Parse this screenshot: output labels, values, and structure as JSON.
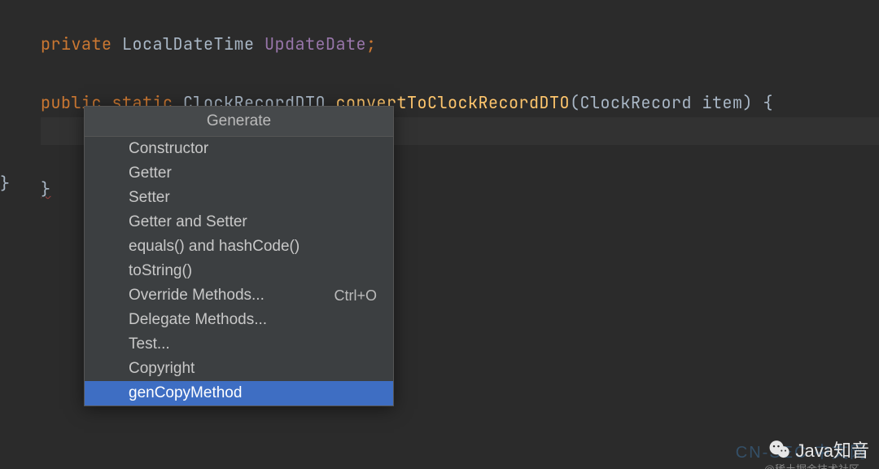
{
  "code": {
    "line1": {
      "kw": "private",
      "type": "LocalDateTime",
      "field": "UpdateDate",
      "semi": ";"
    },
    "line3": {
      "kw1": "public",
      "kw2": "static",
      "ret": "ClockRecordDTO",
      "method": "convertToClockRecordDTO",
      "lparen": "(",
      "ptype": "ClockRecord",
      "pname": "item",
      "rparen": ")",
      "lbrace": "{"
    },
    "line5": {
      "rbrace": "}"
    },
    "line7": {
      "rbrace": "}"
    }
  },
  "popup": {
    "title": "Generate",
    "items": [
      {
        "label": "Constructor",
        "shortcut": ""
      },
      {
        "label": "Getter",
        "shortcut": ""
      },
      {
        "label": "Setter",
        "shortcut": ""
      },
      {
        "label": "Getter and Setter",
        "shortcut": ""
      },
      {
        "label": "equals() and hashCode()",
        "shortcut": ""
      },
      {
        "label": "toString()",
        "shortcut": ""
      },
      {
        "label": "Override Methods...",
        "shortcut": "Ctrl+O"
      },
      {
        "label": "Delegate Methods...",
        "shortcut": ""
      },
      {
        "label": "Test...",
        "shortcut": ""
      },
      {
        "label": "Copyright",
        "shortcut": ""
      },
      {
        "label": "genCopyMethod",
        "shortcut": ""
      }
    ],
    "selected_index": 10
  },
  "watermark": {
    "main": "Java知音",
    "sub": "@稀土掘金技术社区",
    "bg": "CN-SEC 中文网"
  }
}
